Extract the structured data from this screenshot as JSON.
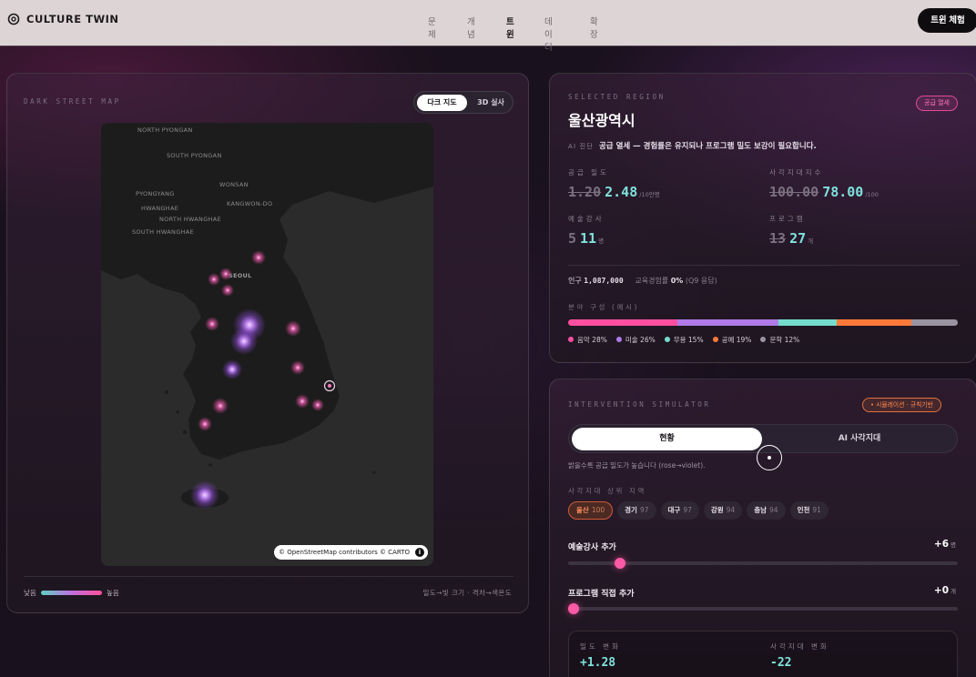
{
  "header": {
    "brand": "CULTURE TWIN",
    "nav": [
      "문제",
      "개념",
      "트윈",
      "데이터",
      "확장"
    ],
    "active_nav": "트윈",
    "cta": "트윈 체험"
  },
  "map": {
    "title": "DARK STREET MAP",
    "toggle": [
      "다크 지도",
      "3D 실사"
    ],
    "active_toggle": "다크 지도",
    "places": [
      "NORTH PYONGAN",
      "SOUTH PYONGAN",
      "PYONGYANG",
      "WONSAN",
      "KANGWON-DO",
      "HWANGHAE",
      "NORTH HWANGHAE",
      "SOUTH HWANGHAE",
      "SEOUL"
    ],
    "attribution": "© OpenStreetMap contributors © CARTO",
    "info_glyph": "i",
    "legend_low": "낮음",
    "legend_high": "높음",
    "legend_note": "밀도→빛 크기 · 격차→색온도"
  },
  "region": {
    "caption": "SELECTED REGION",
    "badge": "공급 열세",
    "name": "울산광역시",
    "ai_tag": "AI 진단",
    "ai_text": "공급 열세 — 경험률은 유지되나 프로그램 밀도 보강이 필요합니다.",
    "stats": [
      {
        "label": "공급 밀도",
        "old": "1.20",
        "new": "2.48",
        "unit": "/10만명"
      },
      {
        "label": "사각지대지수",
        "old": "100.00",
        "new": "78.00",
        "unit": "/100"
      },
      {
        "label": "예술강사",
        "old": "5",
        "new": "11",
        "unit": "명"
      },
      {
        "label": "프로그램",
        "old": "13",
        "new": "27",
        "unit": "개"
      }
    ],
    "population_label": "인구",
    "population_value": "1,087,000",
    "experience_label": "교육경험률",
    "experience_value": "0%",
    "experience_note": "(Q9 응답)",
    "mix_caption": "분야 구성 (예시)",
    "mix": [
      {
        "name": "음악",
        "pct": 28,
        "color": "#ff4fa0"
      },
      {
        "name": "미술",
        "pct": 26,
        "color": "#b07be8"
      },
      {
        "name": "무용",
        "pct": 15,
        "color": "#74dccb"
      },
      {
        "name": "공예",
        "pct": 19,
        "color": "#ff7a3a"
      },
      {
        "name": "문학",
        "pct": 12,
        "color": "#9a93a2"
      }
    ]
  },
  "simulator": {
    "caption": "INTERVENTION SIMULATOR",
    "badge": "• 시뮬레이션 · 규칙기반",
    "tabs": [
      "현황",
      "AI 사각지대"
    ],
    "active_tab": "현황",
    "note": "밝을수록 공급 밀도가 높습니다 (rose→violet).",
    "chip_caption": "사각지대 상위 지역",
    "chips": [
      {
        "name": "울산",
        "score": "100",
        "active": true
      },
      {
        "name": "경기",
        "score": "97",
        "active": false
      },
      {
        "name": "대구",
        "score": "97",
        "active": false
      },
      {
        "name": "강원",
        "score": "94",
        "active": false
      },
      {
        "name": "충남",
        "score": "94",
        "active": false
      },
      {
        "name": "인천",
        "score": "91",
        "active": false
      }
    ],
    "sliders": [
      {
        "label": "예술강사 추가",
        "value": "+6",
        "unit": "명",
        "level": 0.12
      },
      {
        "label": "프로그램 직접 추가",
        "value": "+0",
        "unit": "개",
        "level": 0
      }
    ],
    "results": [
      {
        "label": "밀도 변화",
        "value": "+1.28"
      },
      {
        "label": "사각지대 변화",
        "value": "-22"
      }
    ]
  }
}
